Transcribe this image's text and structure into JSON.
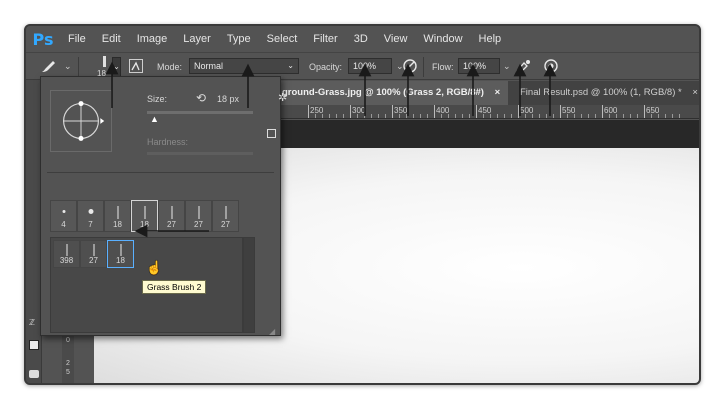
{
  "menubar": {
    "logo": "Ps",
    "items": [
      "File",
      "Edit",
      "Image",
      "Layer",
      "Type",
      "Select",
      "Filter",
      "3D",
      "View",
      "Window",
      "Help"
    ]
  },
  "options": {
    "brush_size": "18",
    "mode_label": "Mode:",
    "mode_value": "Normal",
    "opacity_label": "Opacity:",
    "opacity_value": "100%",
    "flow_label": "Flow:",
    "flow_value": "100%"
  },
  "tabs": [
    {
      "label": "ground-Grass.jpg @ 100% (Grass 2, RGB/8#)",
      "close": "×",
      "active": true
    },
    {
      "label": "Final Result.psd @ 100% (1, RGB/8) *",
      "close": "×",
      "active": false
    }
  ],
  "ruler": [
    "250",
    "300",
    "350",
    "400",
    "450",
    "500",
    "550",
    "600",
    "650"
  ],
  "vertical_ruler": [
    "0",
    "2",
    "5"
  ],
  "brush_picker": {
    "size_label": "Size:",
    "size_value": "18 px",
    "hardness_label": "Hardness:",
    "tips": [
      "4",
      "7",
      "18",
      "18",
      "27",
      "27",
      "27"
    ],
    "brushes": [
      "398",
      "27",
      "18"
    ],
    "tooltip": "Grass Brush 2"
  },
  "icons": [
    "brush-icon",
    "airbrush-icon",
    "pressure-icon",
    "gear-icon",
    "reset-icon"
  ]
}
